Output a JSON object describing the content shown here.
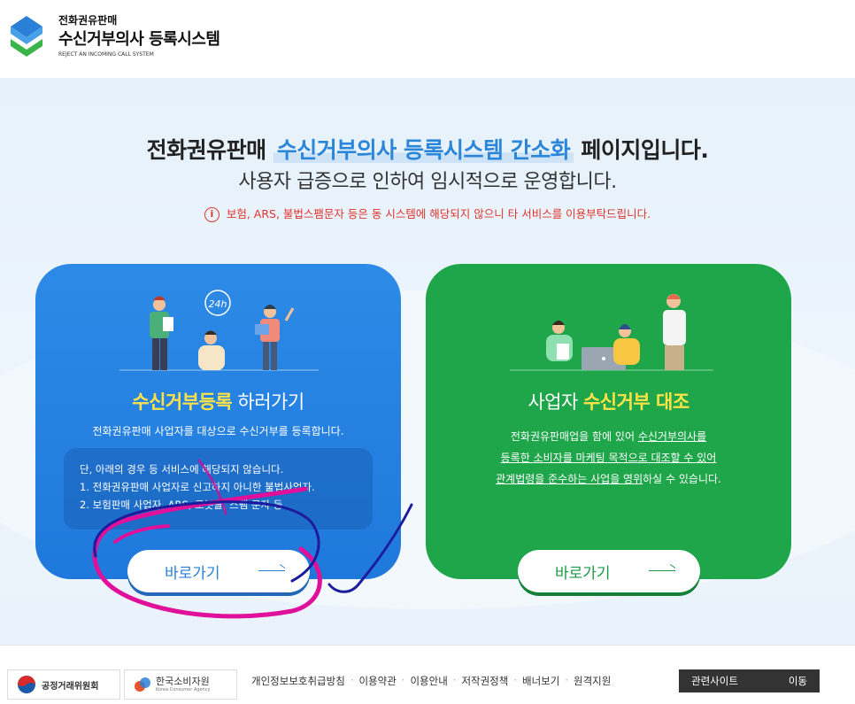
{
  "header": {
    "logo_sub": "전화권유판매",
    "logo_main": "수신거부의사 등록시스템",
    "logo_en": "REJECT AN INCOMING CALL SYSTEM"
  },
  "hero": {
    "title_pre": "전화권유판매 ",
    "title_highlight": "수신거부의사 등록시스템 간소화",
    "title_post": " 페이지입니다.",
    "subtitle": "사용자 급증으로 인하여 임시적으로 운영합니다.",
    "notice": "보험, ARS, 불법스팸문자 등은 동 시스템에 해당되지 않으니 타 서비스를 이용부탁드립니다.",
    "notice_icon": "i"
  },
  "card_register": {
    "title_bold": "수신거부등록",
    "title_rest": " 하러가기",
    "desc": "전화권유판매 사업자를 대상으로 수신거부를 등록합니다.",
    "exception_title": "단, 아래의 경우 등 서비스에 해당되지 않습니다.",
    "exception_1": "1. 전화권유판매 사업자로 신고하지 아니한 불법사업자.",
    "exception_2": "2. 보험판매 사업자, ARS, 로봇콜, 스팸 문자 등",
    "button_label": "바로가기",
    "clock_label": "24h"
  },
  "card_business": {
    "title_pre": "사업자 ",
    "title_bold": "수신거부 대조",
    "desc_line1_pre": "전화권유판매업을 함에 있어 ",
    "desc_line1_u": "수신거부의사를",
    "desc_line2_u": "등록한 소비자를 마케팅 목적으로 대조할 수 있어",
    "desc_line3_u": "관계법령을 준수하는 사업을 영위",
    "desc_line3_post": "하실 수 있습니다.",
    "button_label": "바로가기"
  },
  "footer": {
    "logo1": "공정거래위원회",
    "logo2": "한국소비자원",
    "logo2_en": "Korea Consumer Agency",
    "links": [
      "개인정보보호취급방침",
      "이용약관",
      "이용안내",
      "저작권정책",
      "배너보기",
      "원격지원"
    ],
    "related_label": "관련사이트",
    "related_move": "이동"
  },
  "colors": {
    "blue_card": "#2d8ae6",
    "green_card": "#1fa64a",
    "highlight": "#ffe347",
    "notice_red": "#e0342b",
    "scribble_magenta": "#e0109a",
    "scribble_navy": "#1c1c9c"
  }
}
